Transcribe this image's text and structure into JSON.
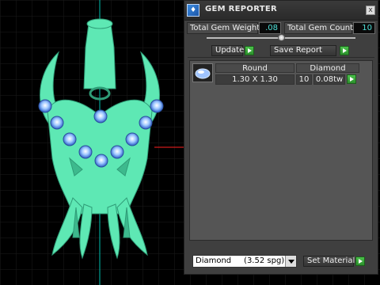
{
  "window": {
    "title": "GEM REPORTER",
    "close_label": "x",
    "icon": "gem-reporter-app-icon"
  },
  "totals": {
    "weight_label": "Total Gem Weight",
    "weight_value": ".08",
    "count_label": "Total Gem Count",
    "count_value": "10"
  },
  "size_slider": {
    "level": 0.5
  },
  "actions": {
    "update_label": "Update",
    "save_report_label": "Save Report"
  },
  "gem_list": {
    "headers": {
      "shape": "Round",
      "material": "Diamond"
    },
    "rows": [
      {
        "icon": "round-gem-icon",
        "size": "1.30 X 1.30",
        "count": "10",
        "weight": "0.08tw"
      }
    ]
  },
  "material": {
    "selected": "Diamond     (3.52 spg)",
    "set_label": "Set Material"
  },
  "colors": {
    "model": "#5ee8b4",
    "gem": "#7eb6ff",
    "grid": "#1a1a1a",
    "accent_axis": "#ff2020",
    "green_axis": "#00c060"
  }
}
